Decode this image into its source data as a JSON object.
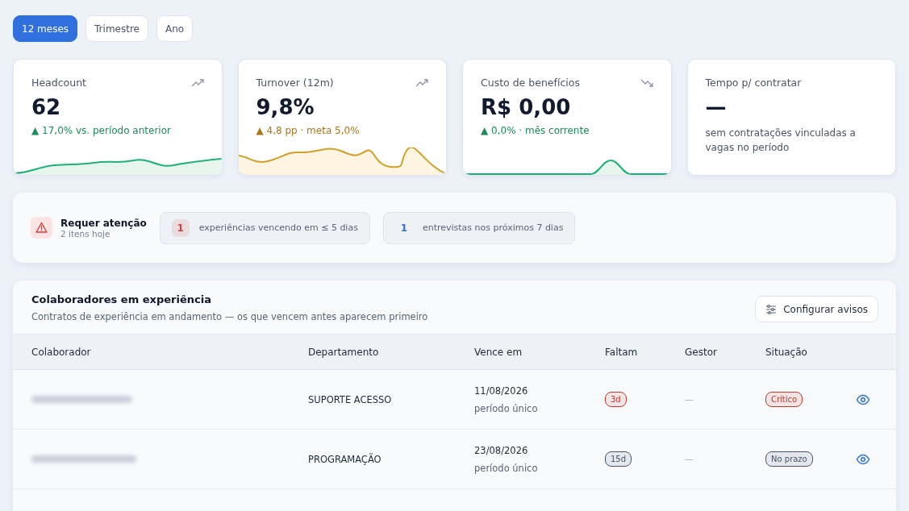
{
  "period_tabs": [
    {
      "label": "12 meses",
      "selected": true
    },
    {
      "label": "Trimestre",
      "selected": false
    },
    {
      "label": "Ano",
      "selected": false
    }
  ],
  "kpis": [
    {
      "title": "Headcount",
      "value": "62",
      "delta": "▲ 17,0% vs. período anterior",
      "color": "#1d8a5a"
    },
    {
      "title": "Turnover (12m)",
      "value": "9,8%",
      "delta": "▲ 4,8 pp · meta 5,0%",
      "color": "#a8781a"
    },
    {
      "title": "Custo de benefícios",
      "value": "R$ 0,00",
      "delta": "▲ 0,0% · mês corrente",
      "color": "#1d8a5a"
    },
    {
      "title": "Tempo p/ contratar",
      "value": "—",
      "note": "sem contratações vinculadas a vagas no período"
    }
  ],
  "attention": {
    "title": "Requer atenção",
    "subtitle": "2 itens hoje",
    "chips": [
      {
        "count": "1",
        "label": "experiências vencendo em ≤ 5 dias",
        "color": "#d0403c"
      },
      {
        "count": "1",
        "label": "entrevistas nos próximos 7 dias",
        "color": "#2f6fde"
      }
    ]
  },
  "experience": {
    "title": "Colaboradores em experiência",
    "subtitle": "Contratos de experiência em andamento — os que vencem antes aparecem primeiro",
    "action": "Configurar avisos",
    "columns": [
      "Colaborador",
      "Departamento",
      "Vence em",
      "Faltam",
      "Gestor",
      "Situação"
    ],
    "rows": [
      {
        "department": "SUPORTE ACESSO",
        "due": "11/08/2026",
        "period": "período único",
        "remaining": {
          "text": "3d",
          "color": "#c0392b"
        },
        "manager": "—",
        "status": {
          "text": "Crítico",
          "color": "#c0392b"
        }
      },
      {
        "department": "PROGRAMAÇÃO",
        "due": "23/08/2026",
        "period": "período único",
        "remaining": {
          "text": "15d",
          "color": "#475569"
        },
        "manager": "—",
        "status": {
          "text": "No prazo",
          "color": "#475569"
        }
      }
    ]
  }
}
